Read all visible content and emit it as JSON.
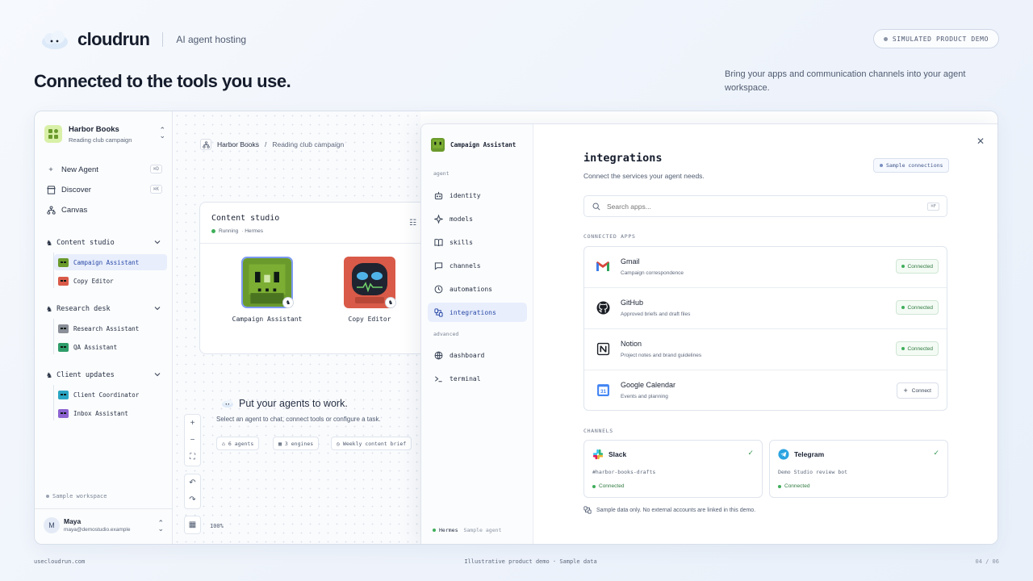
{
  "brand": {
    "name": "cloudrun",
    "tagline": "AI agent hosting",
    "demo_badge": "SIMULATED PRODUCT DEMO"
  },
  "hero": {
    "headline": "Connected to the tools you use.",
    "subhead": "Bring your apps and communication channels into your agent workspace."
  },
  "workspace": {
    "name": "Harbor Books",
    "subtitle": "Reading club campaign"
  },
  "sidebar": {
    "nav": [
      {
        "label": "New Agent",
        "shortcut": "⌘D",
        "icon": "plus-icon"
      },
      {
        "label": "Discover",
        "shortcut": "⌘K",
        "icon": "store-icon"
      },
      {
        "label": "Canvas",
        "shortcut": "",
        "icon": "hierarchy-icon"
      }
    ],
    "groups": [
      {
        "label": "Content studio",
        "agents": [
          {
            "label": "Campaign Assistant",
            "color": "#6a9a2c",
            "active": true
          },
          {
            "label": "Copy Editor",
            "color": "#d95a48",
            "active": false
          }
        ]
      },
      {
        "label": "Research desk",
        "agents": [
          {
            "label": "Research Assistant",
            "color": "#8a8f98",
            "active": false
          },
          {
            "label": "QA Assistant",
            "color": "#2f9d6a",
            "active": false
          }
        ]
      },
      {
        "label": "Client updates",
        "agents": [
          {
            "label": "Client Coordinator",
            "color": "#29a5c4",
            "active": false
          },
          {
            "label": "Inbox Assistant",
            "color": "#8c63d1",
            "active": false
          }
        ]
      }
    ],
    "sample_workspace": "Sample workspace",
    "user": {
      "initial": "M",
      "name": "Maya",
      "email": "maya@demostudio.example"
    }
  },
  "canvas": {
    "breadcrumb": {
      "root": "Harbor Books",
      "sep": "/",
      "page": "Reading club campaign"
    },
    "studio": {
      "title": "Content studio",
      "status": "Running",
      "engine": "· Hermes",
      "agents": [
        "Campaign Assistant",
        "Copy Editor"
      ]
    },
    "empty": {
      "title": "Put your agents to work.",
      "subtitle": "Select an agent to chat, connect tools or configure a task.",
      "chips": [
        "6 agents",
        "3 engines",
        "Weekly content brief"
      ]
    },
    "zoom": "100%"
  },
  "modal": {
    "agent_name": "Campaign Assistant",
    "sections": {
      "agent": "agent",
      "advanced": "advanced"
    },
    "agent_items": [
      {
        "label": "identity",
        "icon": "robot-icon"
      },
      {
        "label": "models",
        "icon": "sparkle-icon"
      },
      {
        "label": "skills",
        "icon": "book-icon"
      },
      {
        "label": "channels",
        "icon": "chat-icon"
      },
      {
        "label": "automations",
        "icon": "clock-icon"
      },
      {
        "label": "integrations",
        "icon": "link-icon"
      }
    ],
    "advanced_items": [
      {
        "label": "dashboard",
        "icon": "globe-icon"
      },
      {
        "label": "terminal",
        "icon": "terminal-icon"
      }
    ],
    "footer": {
      "engine": "Hermes",
      "note": "Sample agent"
    },
    "title": "integrations",
    "subtitle": "Connect the services your agent needs.",
    "sample_badge": "Sample connections",
    "search": {
      "placeholder": "Search apps...",
      "shortcut": "⌘F"
    },
    "connected_label": "CONNECTED APPS",
    "apps": [
      {
        "name": "Gmail",
        "desc": "Campaign correspondence",
        "status": "Connected",
        "icon": "gmail-icon"
      },
      {
        "name": "GitHub",
        "desc": "Approved briefs and draft files",
        "status": "Connected",
        "icon": "github-icon"
      },
      {
        "name": "Notion",
        "desc": "Project notes and brand guidelines",
        "status": "Connected",
        "icon": "notion-icon"
      },
      {
        "name": "Google Calendar",
        "desc": "Events and planning",
        "status": "Connect",
        "icon": "calendar-icon"
      }
    ],
    "channels_label": "CHANNELS",
    "channels": [
      {
        "name": "Slack",
        "desc": "#harbor-books-drafts",
        "status": "Connected",
        "icon": "slack-icon"
      },
      {
        "name": "Telegram",
        "desc": "Demo Studio review bot",
        "status": "Connected",
        "icon": "telegram-icon"
      }
    ],
    "note": "Sample data only. No external accounts are linked in this demo."
  },
  "footer": {
    "left": "usecloudrun.com",
    "center": "Illustrative product demo · Sample data",
    "right": "04 / 06"
  },
  "colors": {
    "accent": "#2b4aa8",
    "accent_bg": "#e8eefc",
    "success": "#2f7a3f",
    "running": "#3fae5a"
  }
}
